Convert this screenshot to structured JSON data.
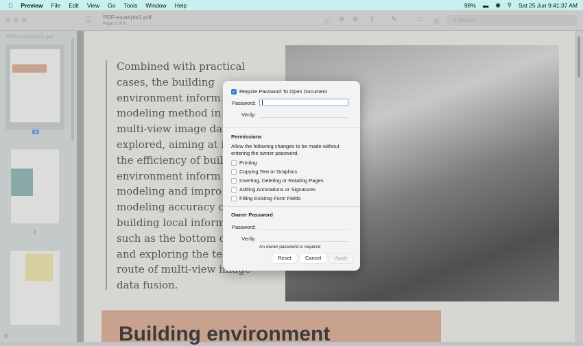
{
  "menubar": {
    "app": "Preview",
    "items": [
      "File",
      "Edit",
      "View",
      "Go",
      "Tools",
      "Window",
      "Help"
    ],
    "battery": "98%",
    "datetime": "Sat 25 Jun  9:41:37 AM"
  },
  "toolbar": {
    "title": "PDF-example1.pdf",
    "subtitle": "Page 1 of 8",
    "search_placeholder": "Search"
  },
  "sidebar": {
    "title": "PDF-example1.pdf",
    "pages": [
      "1",
      "2"
    ]
  },
  "page": {
    "lines": [
      "Combined with practical",
      "cases, the building",
      "environment inform",
      "modeling method in",
      "multi-view image da",
      "explored, aiming at i",
      "the efficiency of buil",
      "environment inform",
      "modeling and impro",
      "modeling accuracy o",
      "building local inform",
      "such as the bottom o",
      "and exploring the tech",
      "route of multi-view image",
      "data fusion."
    ],
    "heading": "Building environment"
  },
  "dialog": {
    "require_label": "Require Password To Open Document",
    "require_checked": true,
    "password_label": "Password:",
    "verify_label": "Verify:",
    "permissions_title": "Permissions",
    "permissions_desc_1": "Allow the following changes to be made without",
    "permissions_desc_2": "entering the owner password.",
    "permissions": [
      "Printing",
      "Copying Text or Graphics",
      "Inserting, Deleting or Rotating Pages",
      "Adding Annotations or Signatures",
      "Filling Existing Form Fields"
    ],
    "owner_title": "Owner Password",
    "owner_note": "An owner password is required",
    "reset": "Reset",
    "cancel": "Cancel",
    "apply": "Apply"
  }
}
